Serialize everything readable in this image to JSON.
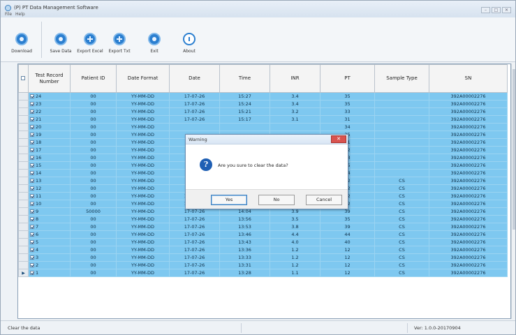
{
  "window": {
    "title": "(P) PT Data Management Software",
    "menu": [
      "File",
      "Help"
    ],
    "controls": [
      "–",
      "□",
      "✕"
    ]
  },
  "toolbar": {
    "download": "Download",
    "save_data": "Save Data",
    "export_excel": "Export Excel",
    "export_txt": "Export Txt",
    "exit": "Exit",
    "about": "About"
  },
  "table": {
    "columns": [
      "",
      "Test Record Number",
      "Patient ID",
      "Date Format",
      "Date",
      "Time",
      "INR",
      "PT",
      "Sample Type",
      "SN"
    ],
    "rows": [
      {
        "num": "24",
        "pid": "00",
        "fmt": "YY-MM-DD",
        "date": "17-07-26",
        "time": "15:27",
        "inr": "3.4",
        "pt": "35",
        "type": "",
        "sn": "392A00002276"
      },
      {
        "num": "23",
        "pid": "00",
        "fmt": "YY-MM-DD",
        "date": "17-07-26",
        "time": "15:24",
        "inr": "3.4",
        "pt": "35",
        "type": "",
        "sn": "392A00002276"
      },
      {
        "num": "22",
        "pid": "00",
        "fmt": "YY-MM-DD",
        "date": "17-07-26",
        "time": "15:21",
        "inr": "3.2",
        "pt": "33",
        "type": "",
        "sn": "392A00002276"
      },
      {
        "num": "21",
        "pid": "00",
        "fmt": "YY-MM-DD",
        "date": "17-07-26",
        "time": "15:17",
        "inr": "3.1",
        "pt": "31",
        "type": "",
        "sn": "392A00002276"
      },
      {
        "num": "20",
        "pid": "00",
        "fmt": "YY-MM-DD",
        "date": "",
        "time": "",
        "inr": "",
        "pt": "34",
        "type": "",
        "sn": "392A00002276"
      },
      {
        "num": "19",
        "pid": "00",
        "fmt": "YY-MM-DD",
        "date": "",
        "time": "",
        "inr": "",
        "pt": "35",
        "type": "",
        "sn": "392A00002276"
      },
      {
        "num": "18",
        "pid": "00",
        "fmt": "YY-MM-DD",
        "date": "",
        "time": "",
        "inr": "",
        "pt": "31",
        "type": "",
        "sn": "392A00002276"
      },
      {
        "num": "17",
        "pid": "00",
        "fmt": "YY-MM-DD",
        "date": "",
        "time": "",
        "inr": "",
        "pt": "32",
        "type": "",
        "sn": "392A00002276"
      },
      {
        "num": "16",
        "pid": "00",
        "fmt": "YY-MM-DD",
        "date": "",
        "time": "",
        "inr": "",
        "pt": "33",
        "type": "",
        "sn": "392A00002276"
      },
      {
        "num": "15",
        "pid": "00",
        "fmt": "YY-MM-DD",
        "date": "",
        "time": "",
        "inr": "",
        "pt": "35",
        "type": "",
        "sn": "392A00002276"
      },
      {
        "num": "14",
        "pid": "00",
        "fmt": "YY-MM-DD",
        "date": "",
        "time": "",
        "inr": "",
        "pt": "34",
        "type": "",
        "sn": "392A00002276"
      },
      {
        "num": "13",
        "pid": "00",
        "fmt": "YY-MM-DD",
        "date": "",
        "time": "",
        "inr": "",
        "pt": "42",
        "type": "CS",
        "sn": "392A00002276"
      },
      {
        "num": "12",
        "pid": "00",
        "fmt": "YY-MM-DD",
        "date": "",
        "time": "",
        "inr": "",
        "pt": "12",
        "type": "CS",
        "sn": "392A00002276"
      },
      {
        "num": "11",
        "pid": "00",
        "fmt": "YY-MM-DD",
        "date": "17-07-26",
        "time": "14:10",
        "inr": "1.1",
        "pt": "12",
        "type": "CS",
        "sn": "392A00002276"
      },
      {
        "num": "10",
        "pid": "00",
        "fmt": "YY-MM-DD",
        "date": "17-07-26",
        "time": "14:07",
        "inr": "1.2",
        "pt": "12",
        "type": "CS",
        "sn": "392A00002276"
      },
      {
        "num": "9",
        "pid": "50000",
        "fmt": "YY-MM-DD",
        "date": "17-07-26",
        "time": "14:04",
        "inr": "3.9",
        "pt": "39",
        "type": "CS",
        "sn": "392A00002276"
      },
      {
        "num": "8",
        "pid": "00",
        "fmt": "YY-MM-DD",
        "date": "17-07-26",
        "time": "13:56",
        "inr": "3.5",
        "pt": "35",
        "type": "CS",
        "sn": "392A00002276"
      },
      {
        "num": "7",
        "pid": "00",
        "fmt": "YY-MM-DD",
        "date": "17-07-26",
        "time": "13:53",
        "inr": "3.8",
        "pt": "39",
        "type": "CS",
        "sn": "392A00002276"
      },
      {
        "num": "6",
        "pid": "00",
        "fmt": "YY-MM-DD",
        "date": "17-07-26",
        "time": "13:46",
        "inr": "4.4",
        "pt": "44",
        "type": "CS",
        "sn": "392A00002276"
      },
      {
        "num": "5",
        "pid": "00",
        "fmt": "YY-MM-DD",
        "date": "17-07-26",
        "time": "13:43",
        "inr": "4.0",
        "pt": "40",
        "type": "CS",
        "sn": "392A00002276"
      },
      {
        "num": "4",
        "pid": "00",
        "fmt": "YY-MM-DD",
        "date": "17-07-26",
        "time": "13:36",
        "inr": "1.2",
        "pt": "12",
        "type": "CS",
        "sn": "392A00002276"
      },
      {
        "num": "3",
        "pid": "00",
        "fmt": "YY-MM-DD",
        "date": "17-07-26",
        "time": "13:33",
        "inr": "1.2",
        "pt": "12",
        "type": "CS",
        "sn": "392A00002276"
      },
      {
        "num": "2",
        "pid": "00",
        "fmt": "YY-MM-DD",
        "date": "17-07-26",
        "time": "13:31",
        "inr": "1.2",
        "pt": "12",
        "type": "CS",
        "sn": "392A00002276"
      },
      {
        "num": "1",
        "pid": "00",
        "fmt": "YY-MM-DD",
        "date": "17-07-26",
        "time": "13:28",
        "inr": "1.1",
        "pt": "12",
        "type": "CS",
        "sn": "392A00002276"
      }
    ]
  },
  "dialog": {
    "title": "Warning",
    "close": "✕",
    "message": "Are you sure to clear the data?",
    "yes": "Yes",
    "no": "No",
    "cancel": "Cancel"
  },
  "status": {
    "left": "Clear the data",
    "version": "Ver: 1.0.0-20170904"
  },
  "colors": {
    "row_fill": "#7ec8f0",
    "accent": "#2b7fd0",
    "dialog_close": "#d9534f"
  }
}
